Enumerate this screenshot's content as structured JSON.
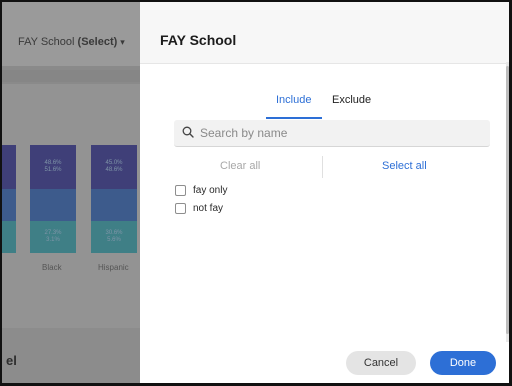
{
  "background": {
    "filter": {
      "name": "FAY School",
      "state": "(Select)"
    },
    "bars": [
      {
        "label": "Black",
        "segments": [
          [
            "48.6%",
            "51.6%"
          ],
          [
            "",
            ""
          ],
          [
            "27.3%",
            "3.1%"
          ]
        ]
      },
      {
        "label": "Hispanic",
        "segments": [
          [
            "45.0%",
            "48.6%"
          ],
          [
            "",
            ""
          ],
          [
            "30.6%",
            "5.6%"
          ]
        ]
      }
    ],
    "bottom_text": "el"
  },
  "modal": {
    "title": "FAY School",
    "tabs": {
      "include": "Include",
      "exclude": "Exclude"
    },
    "search": {
      "placeholder": "Search by name",
      "value": ""
    },
    "clear_all": "Clear all",
    "select_all": "Select all",
    "options": [
      {
        "label": "fay only",
        "checked": false
      },
      {
        "label": "not fay",
        "checked": false
      }
    ],
    "buttons": {
      "cancel": "Cancel",
      "done": "Done"
    }
  },
  "colors": {
    "accent": "#2d6fd6",
    "overlay": "#8a8a8a"
  }
}
